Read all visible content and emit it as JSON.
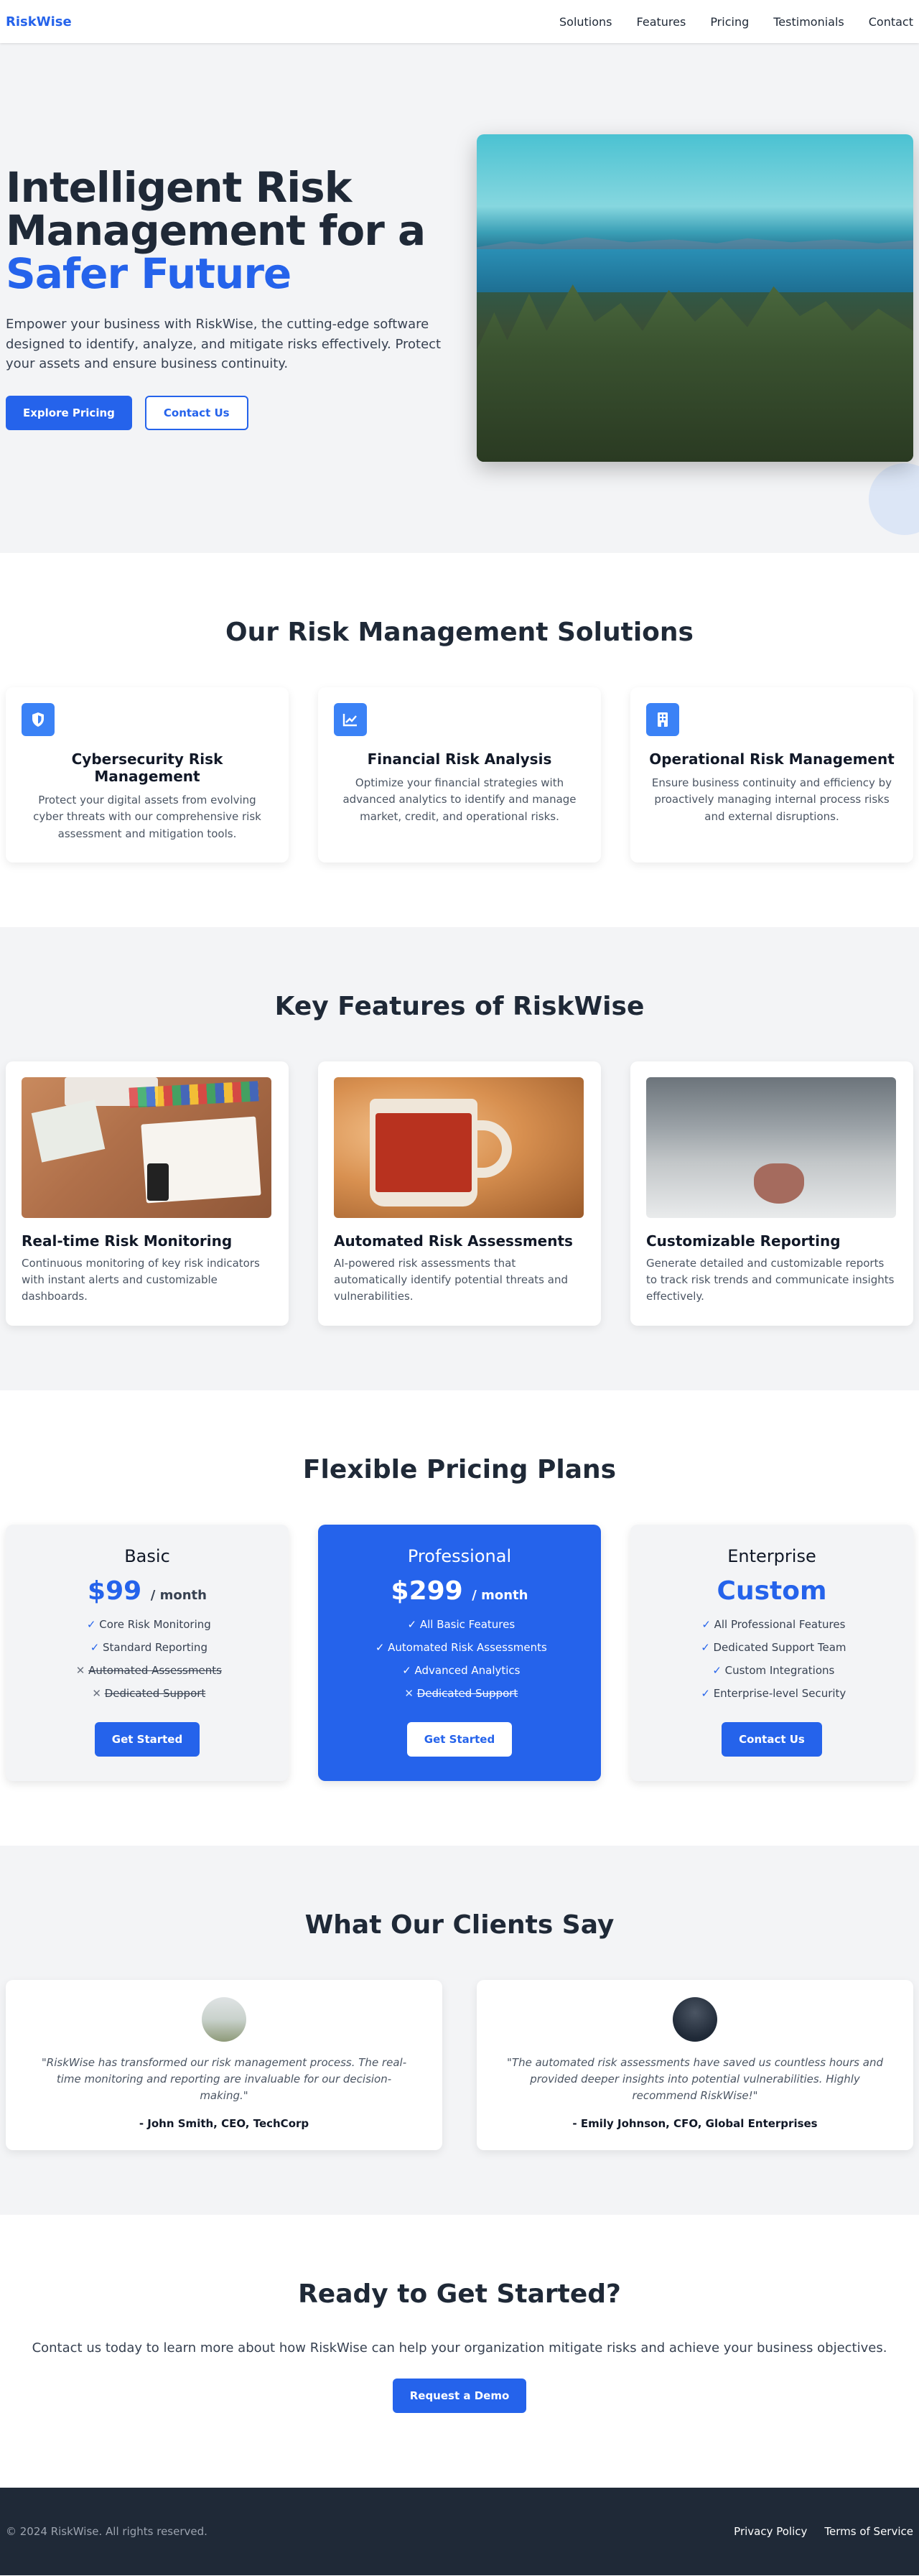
{
  "nav": {
    "brand": "RiskWise",
    "links": [
      "Solutions",
      "Features",
      "Pricing",
      "Testimonials",
      "Contact"
    ]
  },
  "hero": {
    "title_line1": "Intelligent Risk",
    "title_line2": "Management for a",
    "title_accent": "Safer Future",
    "subtitle": "Empower your business with RiskWise, the cutting-edge software designed to identify, analyze, and mitigate risks effectively. Protect your assets and ensure business continuity.",
    "primary_button": "Explore Pricing",
    "secondary_button": "Contact Us"
  },
  "solutions": {
    "title": "Our Risk Management Solutions",
    "items": [
      {
        "icon": "shield-icon",
        "title": "Cybersecurity Risk Management",
        "desc": "Protect your digital assets from evolving cyber threats with our comprehensive risk assessment and mitigation tools."
      },
      {
        "icon": "chart-line-icon",
        "title": "Financial Risk Analysis",
        "desc": "Optimize your financial strategies with advanced analytics to identify and manage market, credit, and operational risks."
      },
      {
        "icon": "building-icon",
        "title": "Operational Risk Management",
        "desc": "Ensure business continuity and efficiency by proactively managing internal process risks and external disruptions."
      }
    ]
  },
  "features": {
    "title": "Key Features of RiskWise",
    "items": [
      {
        "title": "Real-time Risk Monitoring",
        "desc": "Continuous monitoring of key risk indicators with instant alerts and customizable dashboards."
      },
      {
        "title": "Automated Risk Assessments",
        "desc": "AI-powered risk assessments that automatically identify potential threats and vulnerabilities."
      },
      {
        "title": "Customizable Reporting",
        "desc": "Generate detailed and customizable reports to track risk trends and communicate insights effectively."
      }
    ]
  },
  "pricing": {
    "title": "Flexible Pricing Plans",
    "plans": [
      {
        "name": "Basic",
        "price": "$99",
        "per": "/ month",
        "button": "Get Started",
        "items": [
          [
            "✓",
            "Core Risk Monitoring"
          ],
          [
            "✓",
            "Standard Reporting"
          ],
          [
            "✕",
            "Automated Assessments"
          ],
          [
            "✕",
            "Dedicated Support"
          ]
        ]
      },
      {
        "name": "Professional",
        "price": "$299",
        "per": "/ month",
        "button": "Get Started",
        "items": [
          [
            "✓",
            "All Basic Features"
          ],
          [
            "✓",
            "Automated Risk Assessments"
          ],
          [
            "✓",
            "Advanced Analytics"
          ],
          [
            "✕",
            "Dedicated Support"
          ]
        ]
      },
      {
        "name": "Enterprise",
        "price": "Custom",
        "per": "",
        "button": "Contact Us",
        "items": [
          [
            "✓",
            "All Professional Features"
          ],
          [
            "✓",
            "Dedicated Support Team"
          ],
          [
            "✓",
            "Custom Integrations"
          ],
          [
            "✓",
            "Enterprise-level Security"
          ]
        ]
      }
    ]
  },
  "testimonials": {
    "title": "What Our Clients Say",
    "items": [
      {
        "quote": "\"RiskWise has transformed our risk management process. The real-time monitoring and reporting are invaluable for our decision-making.\"",
        "author": "- John Smith, CEO, TechCorp"
      },
      {
        "quote": "\"The automated risk assessments have saved us countless hours and provided deeper insights into potential vulnerabilities. Highly recommend RiskWise!\"",
        "author": "- Emily Johnson, CFO, Global Enterprises"
      }
    ]
  },
  "cta": {
    "title": "Ready to Get Started?",
    "text": "Contact us today to learn more about how RiskWise can help your organization mitigate risks and achieve your business objectives.",
    "button": "Request a Demo"
  },
  "footer": {
    "copyright": "© 2024 RiskWise. All rights reserved.",
    "links": [
      "Privacy Policy",
      "Terms of Service"
    ]
  },
  "colors": {
    "accent": "#2563eb",
    "dark": "#1f2937",
    "section_gray": "#f3f4f6"
  }
}
